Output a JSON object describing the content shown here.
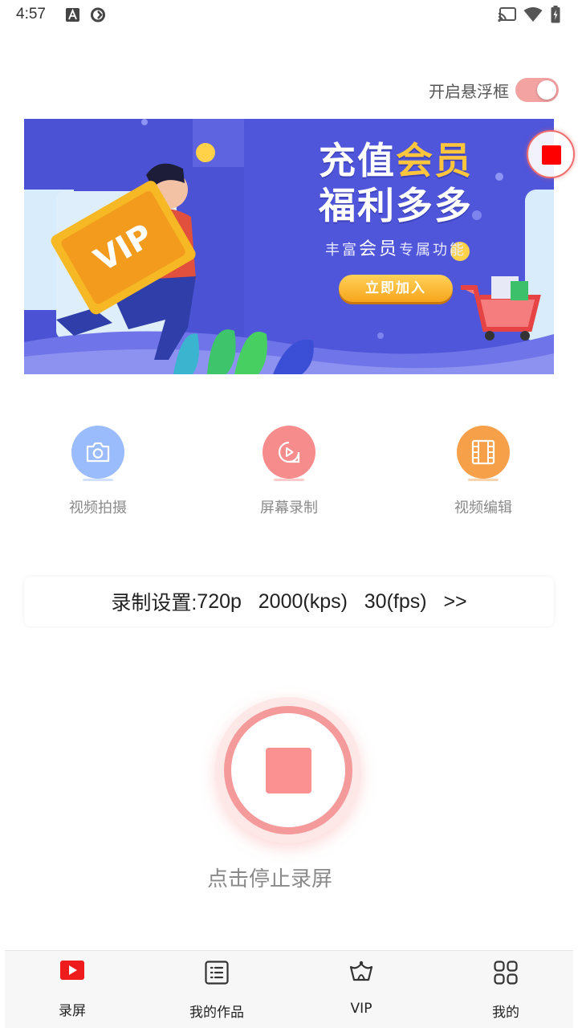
{
  "status_bar": {
    "time": "4:57"
  },
  "floating_toggle": {
    "label": "开启悬浮框",
    "on": true
  },
  "banner": {
    "line1_a": "充值",
    "line1_b": "会员",
    "line2": "福利多多",
    "sub_a": "丰富",
    "sub_b": "会员",
    "sub_c": "专属功能",
    "button": "立即加入",
    "card_text": "VIP"
  },
  "features": [
    {
      "label": "视频拍摄",
      "icon": "camera-icon",
      "color": "#9bbcfc"
    },
    {
      "label": "屏幕录制",
      "icon": "screen-record-icon",
      "color": "#f68c8c"
    },
    {
      "label": "视频编辑",
      "icon": "film-icon",
      "color": "#f7a04a"
    }
  ],
  "record_settings": {
    "prefix": "录制设置:",
    "resolution": "720p",
    "bitrate": "2000(kps)",
    "fps": "30(fps)",
    "arrow": ">>"
  },
  "stop_button": {
    "label": "点击停止录屏",
    "color": "#fb9191"
  },
  "nav": [
    {
      "label": "录屏",
      "icon": "record-play-icon",
      "active": true
    },
    {
      "label": "我的作品",
      "icon": "list-icon",
      "active": false
    },
    {
      "label": "VIP",
      "icon": "crown-icon",
      "active": false
    },
    {
      "label": "我的",
      "icon": "grid-icon",
      "active": false
    }
  ],
  "colors": {
    "accent": "#f06d6d",
    "banner_bg": "#4f55d8",
    "toggle_on": "#f4a3a3"
  }
}
